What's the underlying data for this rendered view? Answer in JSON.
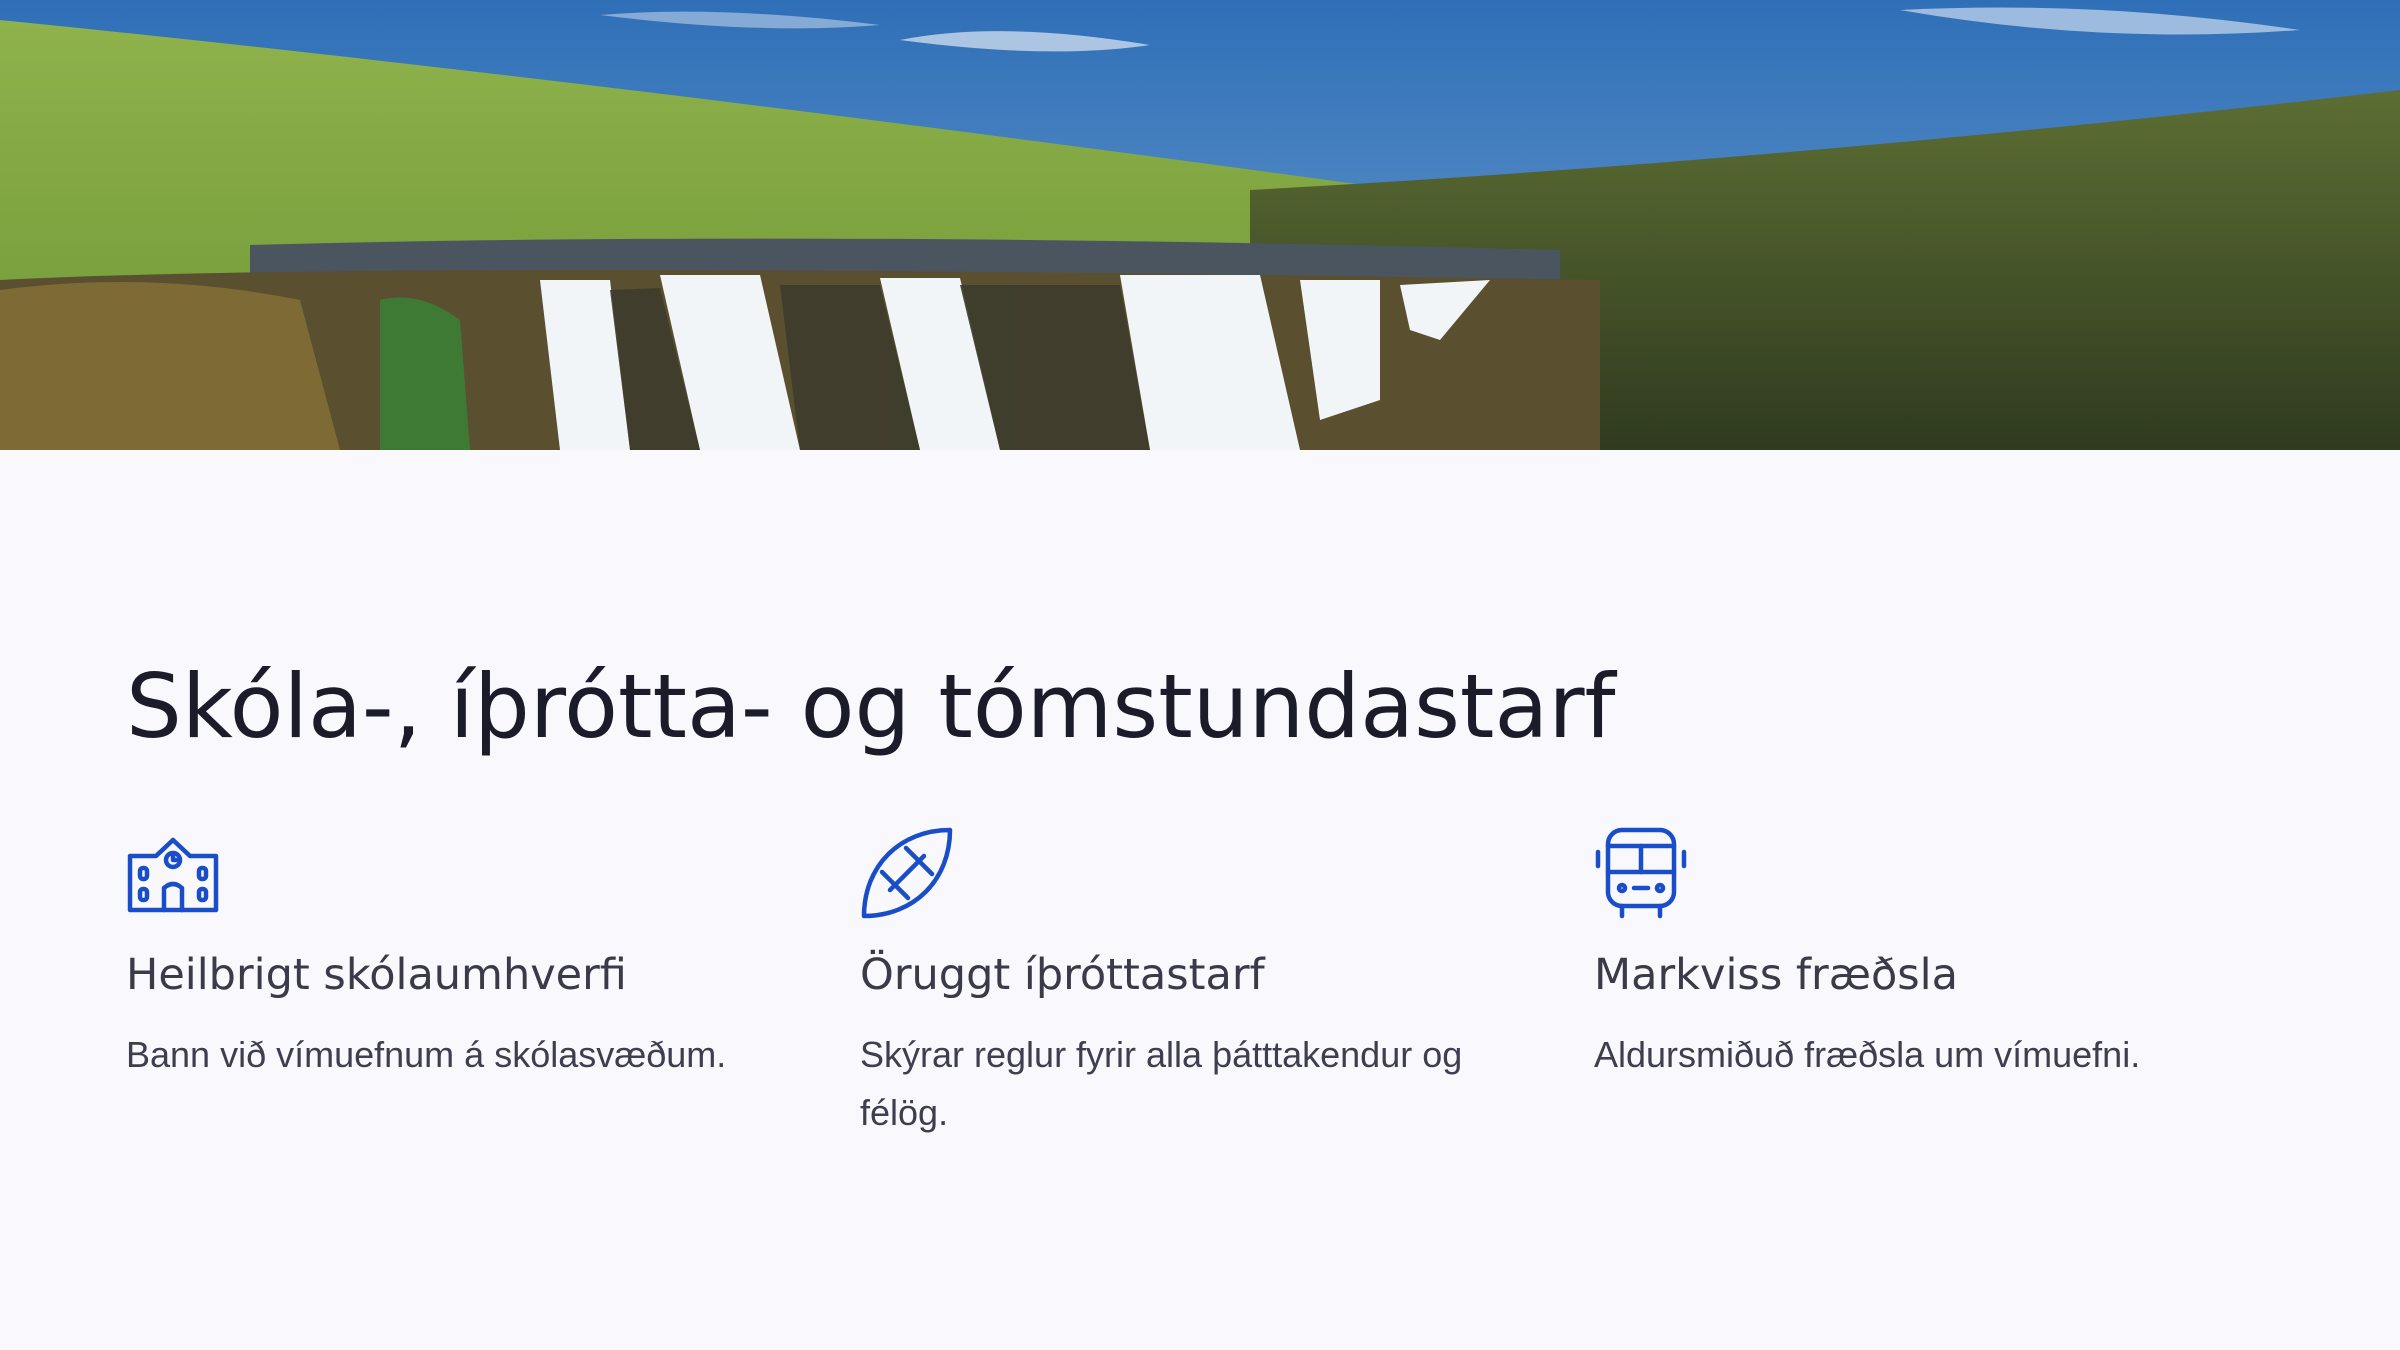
{
  "heading": "Skóla-, íþrótta- og tómstundastarf",
  "hero_image": {
    "description": "waterfall-landscape"
  },
  "accent_color": "#1a4ec8",
  "features": [
    {
      "icon": "school-building-icon",
      "title": "Heilbrigt skólaumhverfi",
      "text": "Bann við vímuefnum á skólasvæðum."
    },
    {
      "icon": "rugby-ball-icon",
      "title": "Öruggt íþróttastarf",
      "text": "Skýrar reglur fyrir alla þátttakendur og félög."
    },
    {
      "icon": "bus-icon",
      "title": "Markviss fræðsla",
      "text": "Aldursmiðuð fræðsla um vímuefni."
    }
  ]
}
